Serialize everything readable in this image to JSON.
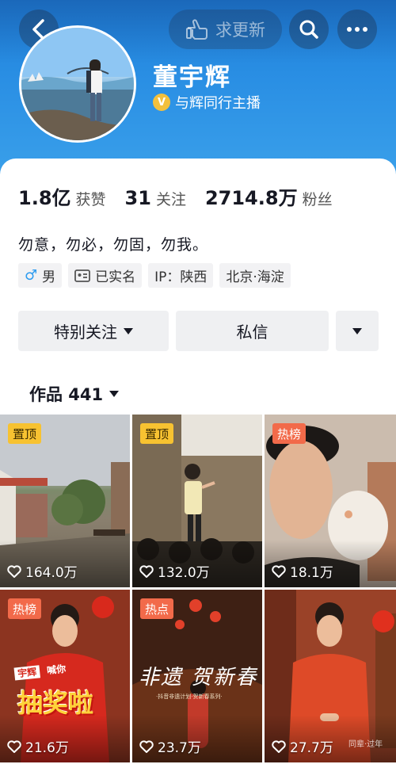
{
  "header": {
    "request_update_label": "求更新",
    "name": "董宇辉",
    "verify_label": "与辉同行主播"
  },
  "stats": [
    {
      "num": "1.8亿",
      "label": "获赞"
    },
    {
      "num": "31",
      "label": "关注"
    },
    {
      "num": "2714.8万",
      "label": "粉丝"
    }
  ],
  "bio": "勿意，勿必，勿固，勿我。",
  "tags": {
    "gender": "男",
    "realname": "已实名",
    "ip": "IP：陕西",
    "location": "北京·海淀"
  },
  "actions": {
    "follow": "特别关注",
    "message": "私信"
  },
  "works": {
    "label": "作品 441"
  },
  "videos": [
    {
      "badge": "置顶",
      "likes": "164.0万"
    },
    {
      "badge": "置顶",
      "likes": "132.0万"
    },
    {
      "badge": "热榜",
      "likes": "18.1万"
    },
    {
      "badge": "热榜",
      "likes": "21.6万",
      "overlay_top": "宇辉",
      "overlay_mid": "喊你",
      "overlay_big": "抽奖啦"
    },
    {
      "badge": "热点",
      "likes": "23.7万",
      "overlay_title": "非遗 贺新春",
      "overlay_sub": "·抖音非遗计划·贺新春系列·"
    },
    {
      "badge": "",
      "likes": "27.7万",
      "overlay_small": "同辈·过年"
    }
  ],
  "colors": {
    "header_blue": "#2a8fe4",
    "pin_badge": "#f7c231",
    "hot_badge": "#f26a4a",
    "verify_gold": "#f3c03c"
  }
}
